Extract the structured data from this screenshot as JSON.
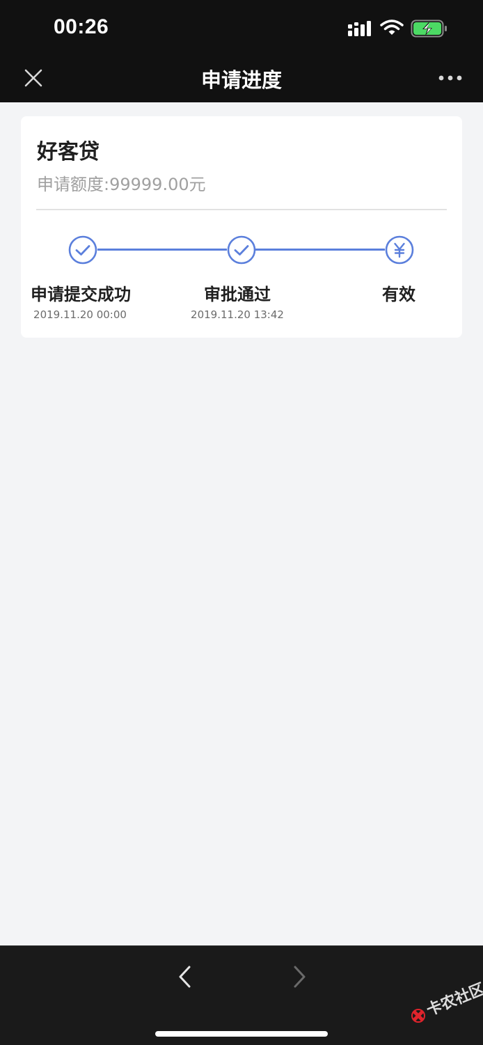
{
  "status_bar": {
    "time": "00:26"
  },
  "nav": {
    "title": "申请进度",
    "close_icon": "close-icon",
    "more_icon": "more-horizontal-icon"
  },
  "card": {
    "product_name": "好客贷",
    "amount_label": "申请额度:",
    "amount_value": "99999.00元",
    "steps": [
      {
        "label": "申请提交成功",
        "time": "2019.11.20 00:00",
        "icon": "check-circle-icon",
        "done": true
      },
      {
        "label": "审批通过",
        "time": "2019.11.20 13:42",
        "icon": "check-circle-icon",
        "done": true
      },
      {
        "label": "有效",
        "time": "",
        "icon": "yen-circle-icon",
        "done": false
      }
    ]
  },
  "bottom_nav": {
    "back_icon": "chevron-left-icon",
    "forward_icon": "chevron-right-icon"
  },
  "watermark": {
    "text": "卡农社区"
  },
  "colors": {
    "accent": "#5b7fdc",
    "nav_bg": "#111111",
    "page_bg": "#f3f4f6",
    "battery": "#4cd964"
  }
}
